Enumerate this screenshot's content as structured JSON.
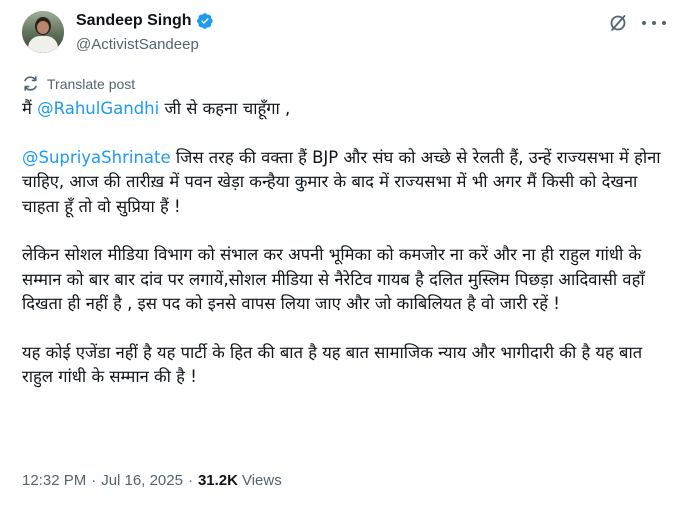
{
  "author": {
    "display_name": "Sandeep Singh",
    "handle": "@ActivistSandeep",
    "verified": true
  },
  "icons": {
    "verified": "verified-badge-icon",
    "grok": "grok-icon",
    "more": "more-options-icon",
    "translate": "translate-icon"
  },
  "colors": {
    "accent": "#1d9bf0",
    "secondary_text": "#536471",
    "primary_text": "#0f1419"
  },
  "translate_label": "Translate post",
  "post": {
    "line1_prefix": "मैं ",
    "mention1": "@RahulGandhi",
    "line1_suffix": " जी से कहना चाहूँगा ,",
    "mention2": "@SupriyaShrinate",
    "para2_text": " जिस तरह की वक्ता हैं BJP और संघ को अच्छे से रेलती हैं, उन्हें राज्यसभा में होना चाहिए, आज की तारीख़ में पवन खेड़ा कन्हैया कुमार के बाद में राज्यसभा में भी अगर मैं किसी को देखना चाहता हूँ तो वो सुप्रिया हैं !",
    "para3": "लेकिन सोशल मीडिया विभाग को संभाल कर अपनी भूमिका को कमजोर ना करें और ना ही राहुल गांधी के सम्मान को बार बार दांव पर लगायें,सोशल मीडिया से नैरेटिव गायब है दलित मुस्लिम पिछड़ा आदिवासी वहाँ दिखता ही नहीं है , इस पद को इनसे वापस लिया जाए और जो काबिलियत है वो जारी रहें !",
    "para4": "यह कोई एजेंडा नहीं है यह पार्टी के हित की बात है यह बात सामाजिक न्याय और भागीदारी की है यह बात राहुल गांधी के सम्मान की है !"
  },
  "meta": {
    "time": "12:32 PM",
    "separator": "·",
    "date": "Jul 16, 2025",
    "views_count": "31.2K",
    "views_label": "Views"
  }
}
